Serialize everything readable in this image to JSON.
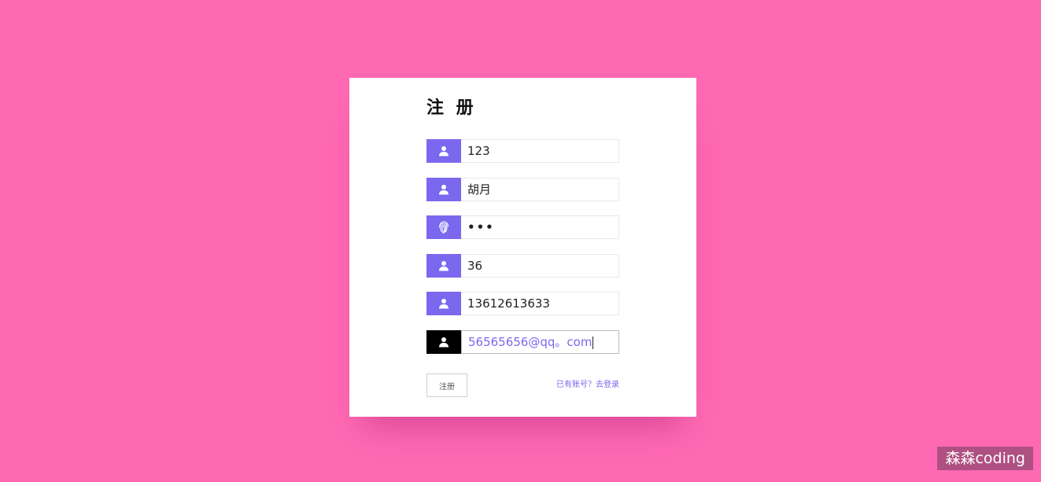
{
  "form": {
    "title": "注 册",
    "fields": [
      {
        "value": "123",
        "icon": "user-icon"
      },
      {
        "value": "胡月",
        "icon": "user-icon"
      },
      {
        "value": "•••",
        "icon": "fingerprint-icon"
      },
      {
        "value": "36",
        "icon": "user-icon"
      },
      {
        "value": "13612613633",
        "icon": "user-icon"
      },
      {
        "value": "56565656@qq。com",
        "icon": "user-icon"
      }
    ],
    "submit_label": "注册",
    "login_link": "已有账号？去登录"
  },
  "watermark": "森森coding",
  "colors": {
    "background": "#ff69b4",
    "accent": "#7b68ee",
    "active_icon": "#000000"
  }
}
